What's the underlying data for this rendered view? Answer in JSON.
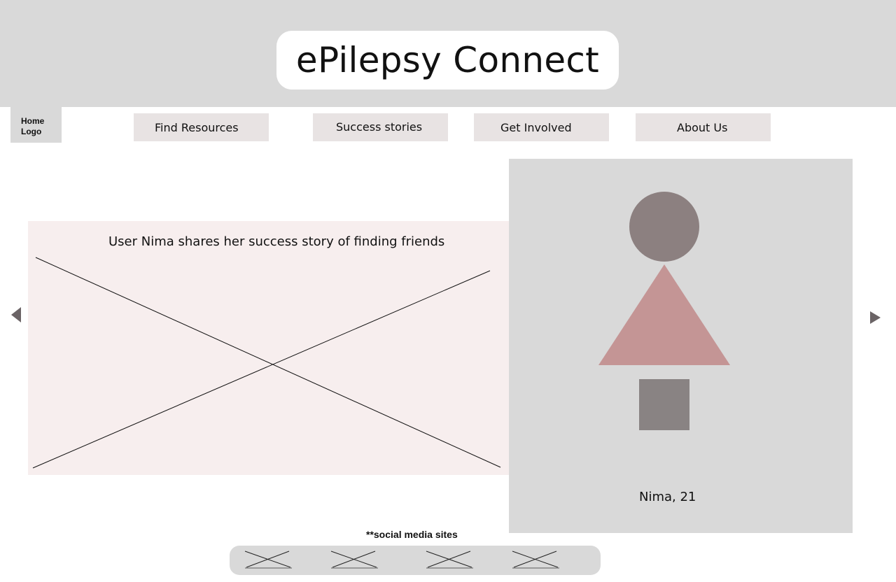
{
  "header": {
    "title": "ePilepsy Connect"
  },
  "home_logo": {
    "label": "Home\nLogo"
  },
  "nav": {
    "items": [
      {
        "label": "Find Resources"
      },
      {
        "label": "Success stories"
      },
      {
        "label": "Get Involved"
      },
      {
        "label": "About Us"
      }
    ]
  },
  "story": {
    "caption": "User Nima shares her success story of finding friends",
    "media_icon": "image-placeholder-icon"
  },
  "carousel": {
    "prev_icon": "chevron-left-icon",
    "next_icon": "chevron-right-icon"
  },
  "profile": {
    "name": "Nima, 21"
  },
  "social": {
    "label": "**social media sites",
    "icons": [
      "social-placeholder-icon",
      "social-placeholder-icon",
      "social-placeholder-icon",
      "social-placeholder-icon"
    ]
  },
  "colors": {
    "header_bg": "#d9d9d9",
    "nav_bg": "#e8e3e3",
    "story_bg": "#f7eeee",
    "avatar_circle": "#8c8080",
    "avatar_triangle": "#c49595",
    "avatar_square": "#898383",
    "arrow": "#6b6466"
  }
}
